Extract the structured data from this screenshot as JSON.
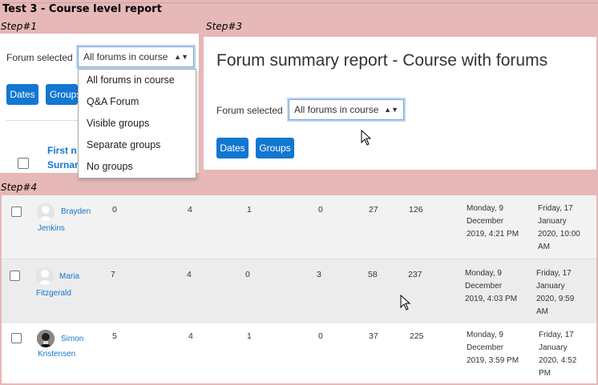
{
  "doc_title": "Test 3 - Course level report",
  "steps": {
    "step1": "Step#1",
    "step3": "Step#3",
    "step4": "Step#4"
  },
  "step1": {
    "forum_label": "Forum selected",
    "select_value": "All forums in course",
    "buttons": {
      "dates": "Dates",
      "groups": "Groups"
    },
    "dropdown_options": [
      "All forums in course",
      "Q&A Forum",
      "Visible groups",
      "Separate groups",
      "No groups"
    ],
    "col_header_top": "First n",
    "col_header_bottom": "Surnar"
  },
  "step3": {
    "title": "Forum summary report - Course with forums",
    "forum_label": "Forum selected",
    "select_value": "All forums in course",
    "buttons": {
      "dates": "Dates",
      "groups": "Groups"
    }
  },
  "step4": {
    "rows": [
      {
        "first": "Brayden",
        "last": "Jenkins",
        "c1": "0",
        "c2": "4",
        "c3": "1",
        "c4": "0",
        "c5": "27",
        "c6": "126",
        "d1": [
          "Monday, 9",
          "December",
          "2019, 4:21 PM"
        ],
        "d2": [
          "Friday, 17",
          "January",
          "2020, 10:00",
          "AM"
        ],
        "avatar": "default"
      },
      {
        "first": "Maria",
        "last": "Fitzgerald",
        "c1": "7",
        "c2": "4",
        "c3": "0",
        "c4": "3",
        "c5": "58",
        "c6": "237",
        "d1": [
          "Monday, 9",
          "December",
          "2019, 4:03 PM"
        ],
        "d2": [
          "Friday, 17",
          "January",
          "2020, 9:59",
          "AM"
        ],
        "avatar": "default"
      },
      {
        "first": "Simon",
        "last": "Kristensen",
        "c1": "5",
        "c2": "4",
        "c3": "1",
        "c4": "0",
        "c5": "37",
        "c6": "225",
        "d1": [
          "Monday, 9",
          "December",
          "2019, 3:59 PM"
        ],
        "d2": [
          "Friday, 17",
          "January",
          "2020, 4:52",
          "PM"
        ],
        "avatar": "photo"
      }
    ]
  },
  "colors": {
    "background": "#e6b8b7",
    "accent": "#1177d1",
    "row_alt": "#f2f2f2"
  }
}
